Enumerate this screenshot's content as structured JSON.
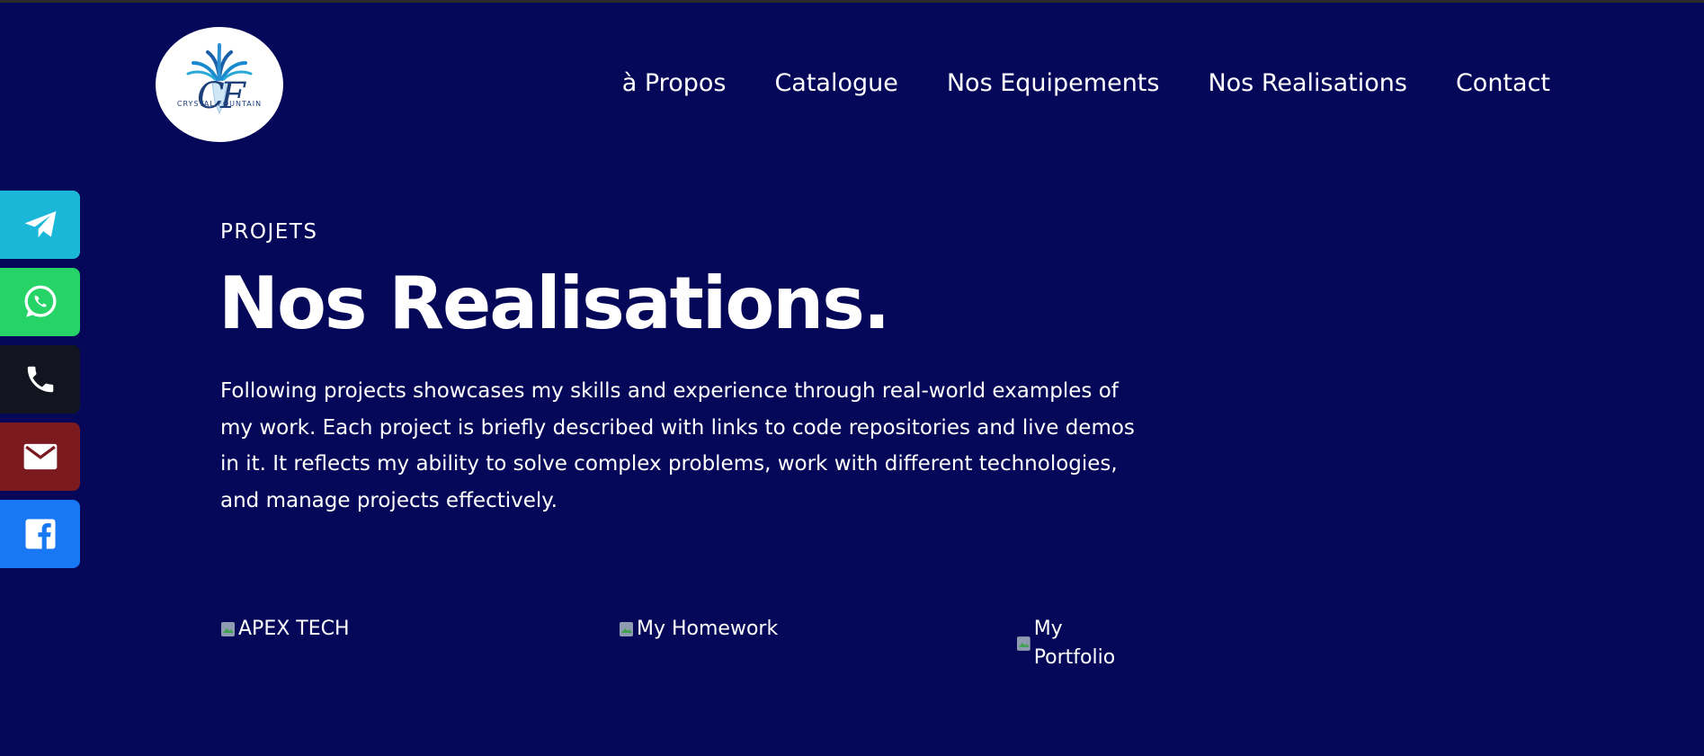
{
  "header": {
    "logo_text": "CRYSTAL FOUNTAIN",
    "logo_monogram": "CF",
    "nav": [
      {
        "label": "à Propos"
      },
      {
        "label": "Catalogue"
      },
      {
        "label": "Nos Equipements"
      },
      {
        "label": "Nos Realisations"
      },
      {
        "label": "Contact"
      }
    ]
  },
  "social": [
    {
      "name": "telegram-icon",
      "color": "#1bb7d9"
    },
    {
      "name": "whatsapp-icon",
      "color": "#25d366"
    },
    {
      "name": "phone-icon",
      "color": "#12151f"
    },
    {
      "name": "mail-icon",
      "color": "#7b1a1f"
    },
    {
      "name": "facebook-icon",
      "color": "#1877f2"
    }
  ],
  "main": {
    "eyebrow": "PROJETS",
    "title": "Nos Realisations.",
    "intro": "Following projects showcases my skills and experience through real-world examples of my work. Each project is briefly described with links to code repositories and live demos in it. It reflects my ability to solve complex problems, work with different technologies, and manage projects effectively."
  },
  "projects": [
    {
      "alt": "APEX TECH"
    },
    {
      "alt": "My Homework"
    },
    {
      "alt": "My Portfolio"
    }
  ],
  "colors": {
    "background": "#050858",
    "text": "#ffffff"
  }
}
